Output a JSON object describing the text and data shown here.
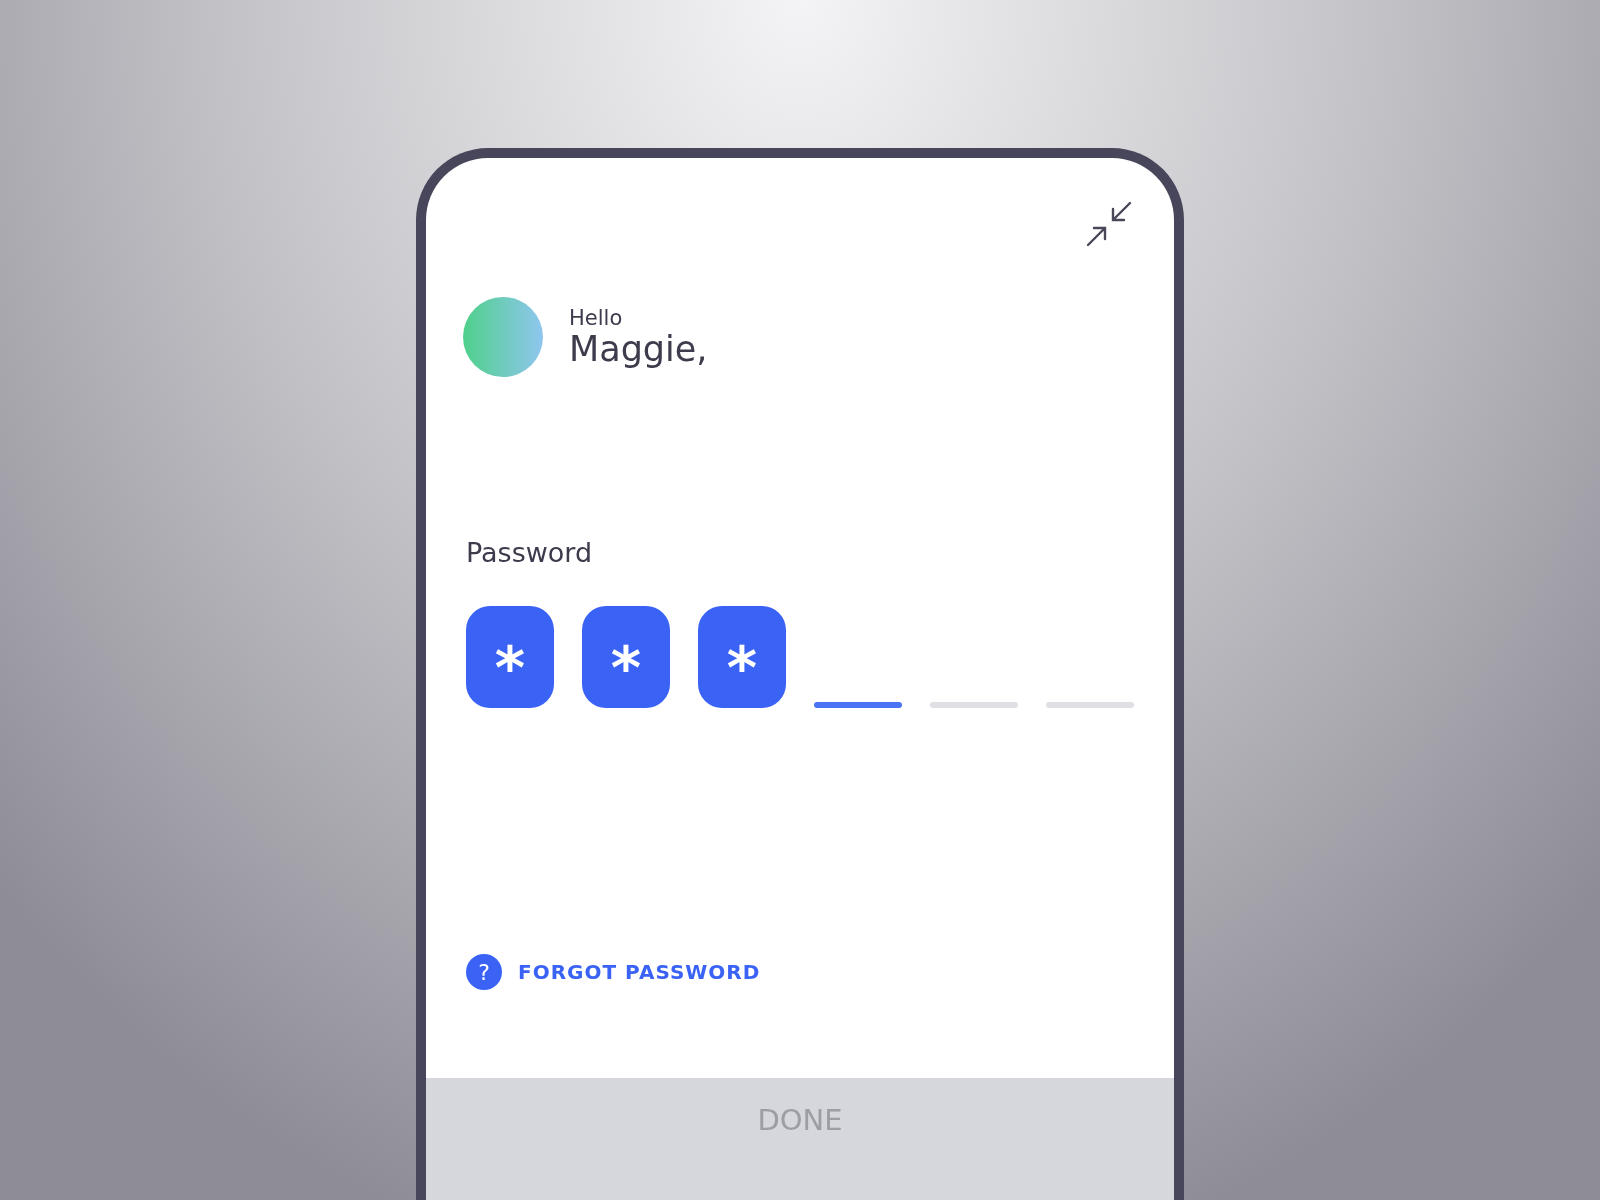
{
  "greeting": "Hello",
  "name": "Maggie,",
  "password": {
    "label": "Password",
    "slots": [
      {
        "kind": "filled",
        "char": "*",
        "selected": false
      },
      {
        "kind": "filled",
        "char": "*",
        "selected": false
      },
      {
        "kind": "filled",
        "char": "*",
        "selected": false
      },
      {
        "kind": "empty",
        "selected": true
      },
      {
        "kind": "empty",
        "selected": false
      },
      {
        "kind": "empty",
        "selected": false
      }
    ]
  },
  "forgot": {
    "icon": "?",
    "label": "FORGOT PASSWORD"
  },
  "done": {
    "label": "DONE",
    "disabled": true
  }
}
